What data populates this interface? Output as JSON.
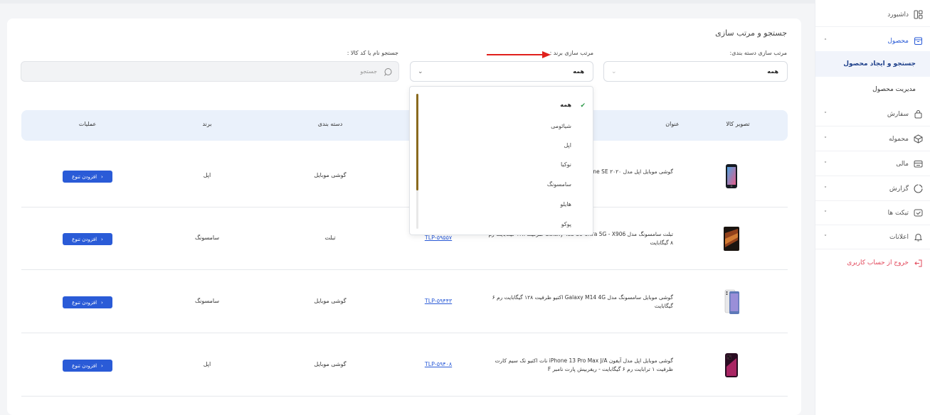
{
  "sidebar": {
    "items": [
      {
        "label": "داشبورد",
        "icon": "dashboard-icon",
        "has_chevron": false
      },
      {
        "label": "محصول",
        "icon": "box-icon",
        "has_chevron": true,
        "chevron": "˄"
      },
      {
        "label": "سفارش",
        "icon": "bag-icon",
        "has_chevron": true,
        "chevron": "˅"
      },
      {
        "label": "محموله",
        "icon": "package-icon",
        "has_chevron": true,
        "chevron": "˅"
      },
      {
        "label": "مالی",
        "icon": "wallet-icon",
        "has_chevron": true,
        "chevron": "˅"
      },
      {
        "label": "گزارش",
        "icon": "chart-icon",
        "has_chevron": true,
        "chevron": "˅"
      },
      {
        "label": "تیکت ها",
        "icon": "ticket-icon",
        "has_chevron": true,
        "chevron": "˅"
      },
      {
        "label": "اعلانات",
        "icon": "bell-icon",
        "has_chevron": true,
        "chevron": "˅"
      }
    ],
    "sub_items": [
      "جستجو و ایجاد محصول",
      "مدیریت محصول"
    ],
    "logout": "خروج از حساب کاربری"
  },
  "filters": {
    "title": "جستجو و مرتب سازی",
    "category_label": "مرتب سازی دسته بندی:",
    "category_value": "همه",
    "brand_label": "مرتب سازی برند :",
    "brand_value": "همه",
    "search_label": "جستجو نام یا کد کالا :",
    "search_placeholder": "جستجو"
  },
  "dropdown": {
    "options": [
      "همه",
      "شیائومی",
      "اپل",
      "نوکیا",
      "سامسونگ",
      "هایلو",
      "پوکو"
    ],
    "selected": "همه"
  },
  "table": {
    "headers": {
      "image": "تصویر کالا",
      "title": "عنوان",
      "category": "دسته بندی",
      "brand": "برند",
      "actions": "عملیات"
    },
    "action_label": "افزودن تنوع",
    "rows": [
      {
        "title": "گوشی موبایل اپل مدل iPhone SE ۲۰۲۰ ظرفیت ۶۴ گیگابایت",
        "code": "",
        "category": "گوشی موبایل",
        "brand": "اپل"
      },
      {
        "title": "تبلت سامسونگ مدل Galaxy Tab S8 Ultra 5G - X906 ظرفیت ۱۲۸ گیگابایت رم ۸ گیگابایت",
        "code": "TLP-۵۹۵۵۷",
        "category": "تبلت",
        "brand": "سامسونگ"
      },
      {
        "title": "گوشی موبایل سامسونگ مدل Galaxy M14 4G اکتیو ظرفیت ۱۲۸ گیگابایت رم ۶ گیگابایت",
        "code": "TLP-۵۹۴۴۳",
        "category": "گوشی موبایل",
        "brand": "سامسونگ"
      },
      {
        "title": "گوشی موبایل اپل مدل آیفون iPhone 13 Pro Max J/A نات اکتیو تک سیم کارت ظرفیت ۱ ترابایت رم ۶ گیگابایت - ریفربیش پارت نامبر F",
        "code": "TLP-۵۹۴۰۸",
        "category": "گوشی موبایل",
        "brand": "اپل"
      }
    ]
  },
  "colors": {
    "accent": "#2a5bd7",
    "logout": "#e2475a",
    "check": "#2e9a4a",
    "scroll_thumb": "#8a6a1e",
    "arrow": "#e0201c"
  }
}
